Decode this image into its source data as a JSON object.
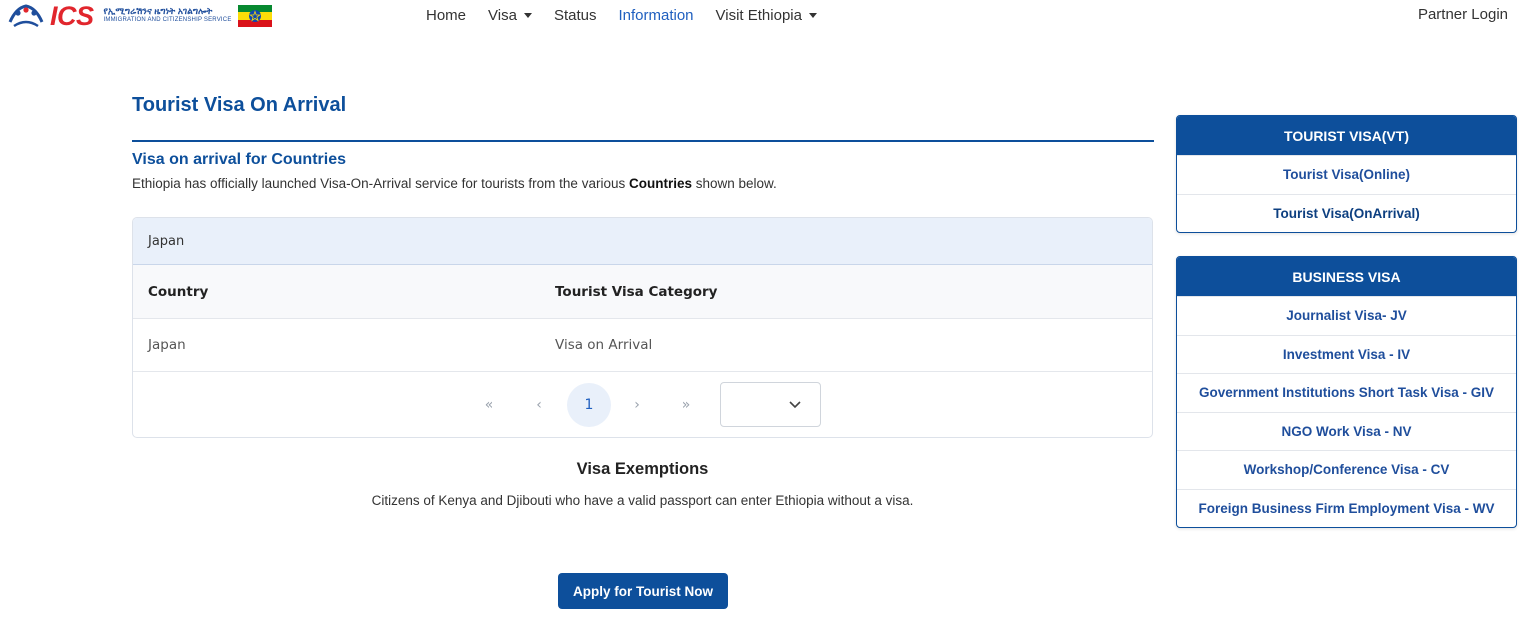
{
  "brand": {
    "logo_text": "ICS",
    "amharic_line": "የኢሚግሬሽንና ዜግነት አገልግሎት",
    "english_line": "IMMIGRATION AND CITIZENSHIP SERVICE",
    "accent_color": "#e1262d",
    "flag_colors": [
      "#078930",
      "#fcdd09",
      "#da121a"
    ]
  },
  "nav": {
    "items": [
      {
        "label": "Home",
        "dropdown": false,
        "active": false
      },
      {
        "label": "Visa",
        "dropdown": true,
        "active": false
      },
      {
        "label": "Status",
        "dropdown": false,
        "active": false
      },
      {
        "label": "Information",
        "dropdown": false,
        "active": true
      },
      {
        "label": "Visit Ethiopia",
        "dropdown": true,
        "active": false
      }
    ],
    "partner_login": "Partner Login"
  },
  "main": {
    "title": "Tourist Visa On Arrival",
    "section_title": "Visa on arrival for Countries",
    "intro_before": "Ethiopia has officially launched Visa-On-Arrival service for tourists from the various ",
    "intro_bold": "Countries",
    "intro_after": " shown below.",
    "table": {
      "filter_value": "Japan",
      "headers": [
        "Country",
        "Tourist Visa Category"
      ],
      "rows": [
        [
          "Japan",
          "Visa on Arrival"
        ]
      ],
      "pager": {
        "first": "«",
        "prev": "‹",
        "current_page": "1",
        "next": "›",
        "last": "»"
      }
    },
    "exemptions_title": "Visa Exemptions",
    "exemptions_text": "Citizens of Kenya and Djibouti who have a valid passport can enter Ethiopia without a visa.",
    "apply_button": "Apply for Tourist Now"
  },
  "side": {
    "tourist": {
      "heading": "TOURIST VISA(VT)",
      "items": [
        "Tourist Visa(Online)",
        "Tourist Visa(OnArrival)"
      ]
    },
    "business": {
      "heading": "BUSINESS VISA",
      "items": [
        "Journalist Visa- JV",
        "Investment Visa - IV",
        "Government Institutions Short Task Visa - GIV",
        "NGO Work Visa - NV",
        "Workshop/Conference Visa - CV",
        "Foreign Business Firm Employment Visa - WV"
      ]
    }
  },
  "colors": {
    "primary": "#0d4f9b",
    "link_active": "#1f5fbf",
    "filter_bg": "#e9f0fa"
  }
}
